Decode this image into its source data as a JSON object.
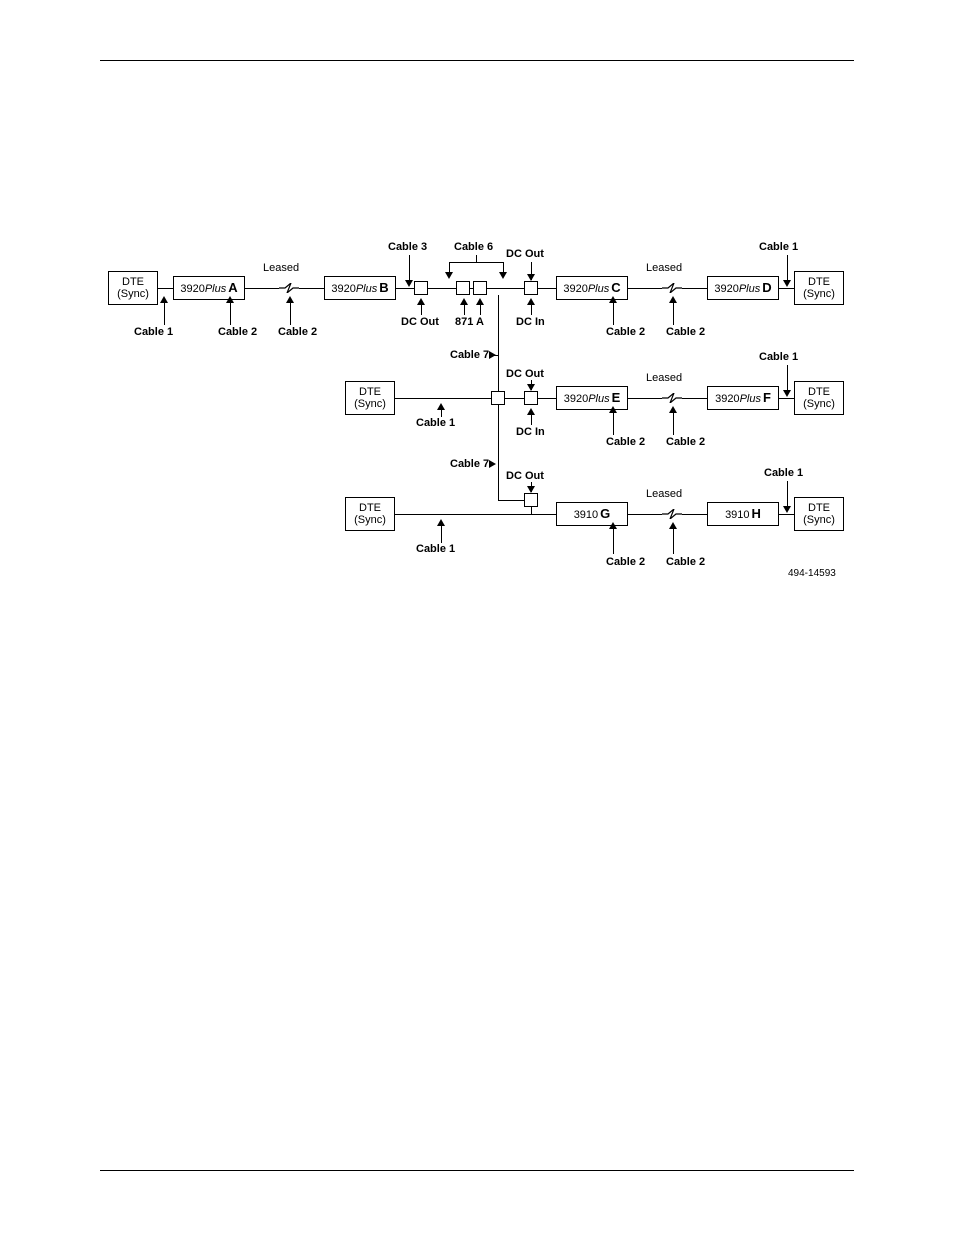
{
  "diagram": {
    "ref": "494-14593",
    "dte": {
      "line1": "DTE",
      "line2": "(Sync)"
    },
    "leased": "Leased",
    "signals": {
      "dc_out": "DC Out",
      "dc_in": "DC In"
    },
    "junction": "871 A",
    "cables": {
      "c1": "Cable 1",
      "c2": "Cable 2",
      "c3": "Cable 3",
      "c6": "Cable 6",
      "c7": "Cable 7"
    },
    "modems": {
      "A": {
        "model": "3920",
        "style": "Plus",
        "suffix": "A"
      },
      "B": {
        "model": "3920",
        "style": "Plus",
        "suffix": "B"
      },
      "C": {
        "model": "3920",
        "style": "Plus",
        "suffix": "C"
      },
      "D": {
        "model": "3920",
        "style": "Plus",
        "suffix": "D"
      },
      "E": {
        "model": "3920",
        "style": "Plus",
        "suffix": "E"
      },
      "F": {
        "model": "3920",
        "style": "Plus",
        "suffix": "F"
      },
      "G": {
        "model": "3910",
        "style": "",
        "suffix": "G"
      },
      "H": {
        "model": "3910",
        "style": "",
        "suffix": "H"
      }
    }
  }
}
